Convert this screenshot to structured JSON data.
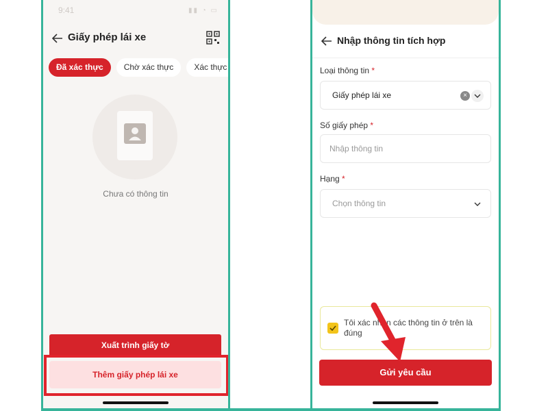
{
  "left": {
    "status_time": "9:41",
    "header_title": "Giấy phép lái xe",
    "tabs": [
      {
        "label": "Đã xác thực",
        "active": true
      },
      {
        "label": "Chờ xác thực",
        "active": false
      },
      {
        "label": "Xác thực khô",
        "active": false
      }
    ],
    "empty_text": "Chưa có thông tin",
    "export_button": "Xuất trình giấy tờ",
    "add_button": "Thêm giấy phép lái xe"
  },
  "right": {
    "header_title": "Nhập thông tin tích hợp",
    "fields": [
      {
        "label": "Loại thông tin",
        "required": "*",
        "value": "Giấy phép lái xe",
        "placeholder": ""
      },
      {
        "label": "Số giấy phép",
        "required": "*",
        "value": "",
        "placeholder": "Nhập thông tin"
      },
      {
        "label": "Hạng",
        "required": "*",
        "value": "",
        "placeholder": "Chọn thông tin"
      }
    ],
    "confirm_text": "Tôi xác nhận các thông tin ở trên là đúng",
    "confirm_checked": true,
    "submit_button": "Gửi yêu cầu"
  },
  "colors": {
    "brand_red": "#d6232a",
    "frame_green": "#37b49a",
    "checkbox_yellow": "#f3c41a"
  },
  "icons": [
    "back-arrow-icon",
    "qr-code-icon",
    "user-document-icon",
    "clear-icon",
    "chevron-down-icon",
    "check-icon",
    "pointer-arrow-icon"
  ]
}
